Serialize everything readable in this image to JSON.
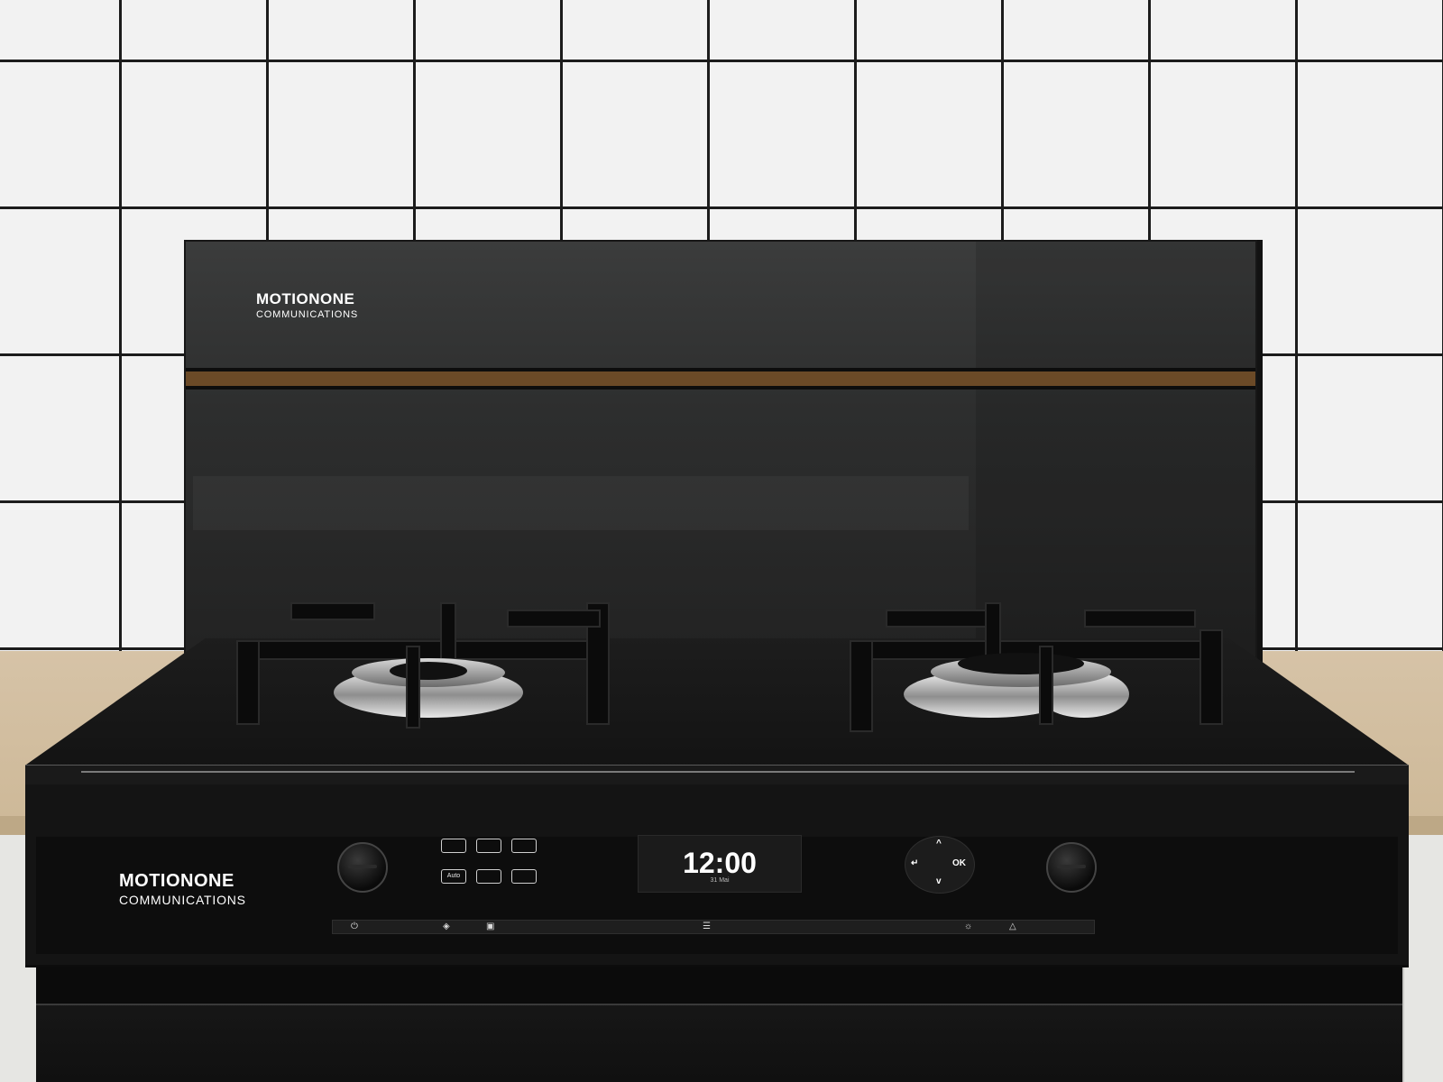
{
  "backsplash": {
    "brand_name": "MOTIONONE",
    "brand_sub": "COMMUNICATIONS"
  },
  "oven": {
    "brand_name": "MOTIONONE",
    "brand_sub": "COMMUNICATIONS",
    "modes_top": [
      "",
      "",
      ""
    ],
    "modes_bottom": [
      "Auto",
      "",
      ""
    ],
    "display": {
      "time": "12:00",
      "date": "31 Mai"
    },
    "dpad": {
      "ok": "OK",
      "up": "^",
      "down": "v",
      "back": "↵"
    }
  },
  "colors": {
    "accent_stripe": "#6b4a27",
    "glass": "#2d2e2e",
    "tile_grout": "#1c1c1c",
    "tile": "#f2f2f2",
    "counter": "#d6c3a7"
  }
}
